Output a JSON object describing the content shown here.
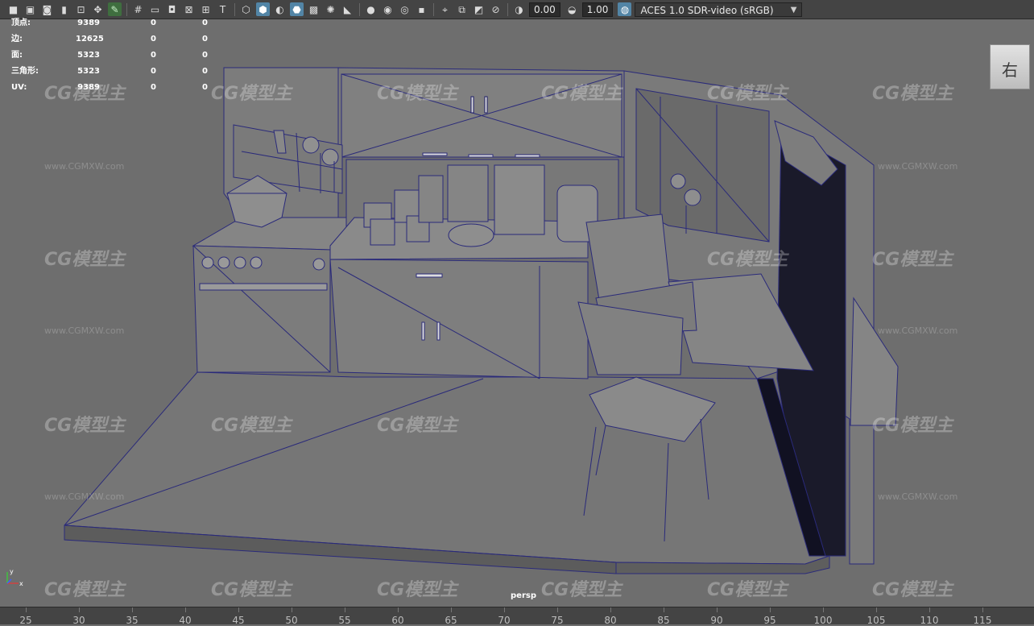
{
  "toolbar": {
    "value_a": "0.00",
    "value_b": "1.00",
    "color_space": "ACES 1.0 SDR-video (sRGB)",
    "icons": [
      "camera-icon",
      "camera-attr-icon",
      "bookmark-icon",
      "bookmark2-icon",
      "image-plane-icon",
      "grid-icon",
      "film-gate-icon",
      "resolution-gate-icon",
      "gate-mask-icon",
      "field-chart-icon",
      "safe-title-icon",
      "wireframe-icon",
      "smooth-shade-icon",
      "default-material-icon",
      "wireframe-on-shaded-icon",
      "texture-icon",
      "lighting-icon",
      "shadows-icon",
      "ambient-occlusion-icon",
      "motion-blur-icon",
      "antialias-icon",
      "isolate-icon",
      "xray-icon",
      "xray-joints-icon",
      "backface-icon",
      "exposure-icon",
      "gamma-icon",
      "color-management-icon"
    ]
  },
  "hud": {
    "rows": [
      {
        "label": "顶点:",
        "v1": "9389",
        "v2": "0",
        "v3": "0"
      },
      {
        "label": "边:",
        "v1": "12625",
        "v2": "0",
        "v3": "0"
      },
      {
        "label": "面:",
        "v1": "5323",
        "v2": "0",
        "v3": "0"
      },
      {
        "label": "三角形:",
        "v1": "5323",
        "v2": "0",
        "v3": "0"
      },
      {
        "label": "UV:",
        "v1": "9389",
        "v2": "0",
        "v3": "0"
      }
    ]
  },
  "viewcube": {
    "face_label": "右"
  },
  "viewport": {
    "camera_label": "persp",
    "axis_x": "x",
    "axis_y": "y"
  },
  "watermark": {
    "brand": "CG模型主",
    "url": "www.CGMXW.com"
  },
  "timeline": {
    "ticks": [
      "25",
      "30",
      "35",
      "40",
      "45",
      "50",
      "55",
      "60",
      "65",
      "70",
      "75",
      "80",
      "85",
      "90",
      "95",
      "100",
      "105",
      "110",
      "115"
    ]
  }
}
